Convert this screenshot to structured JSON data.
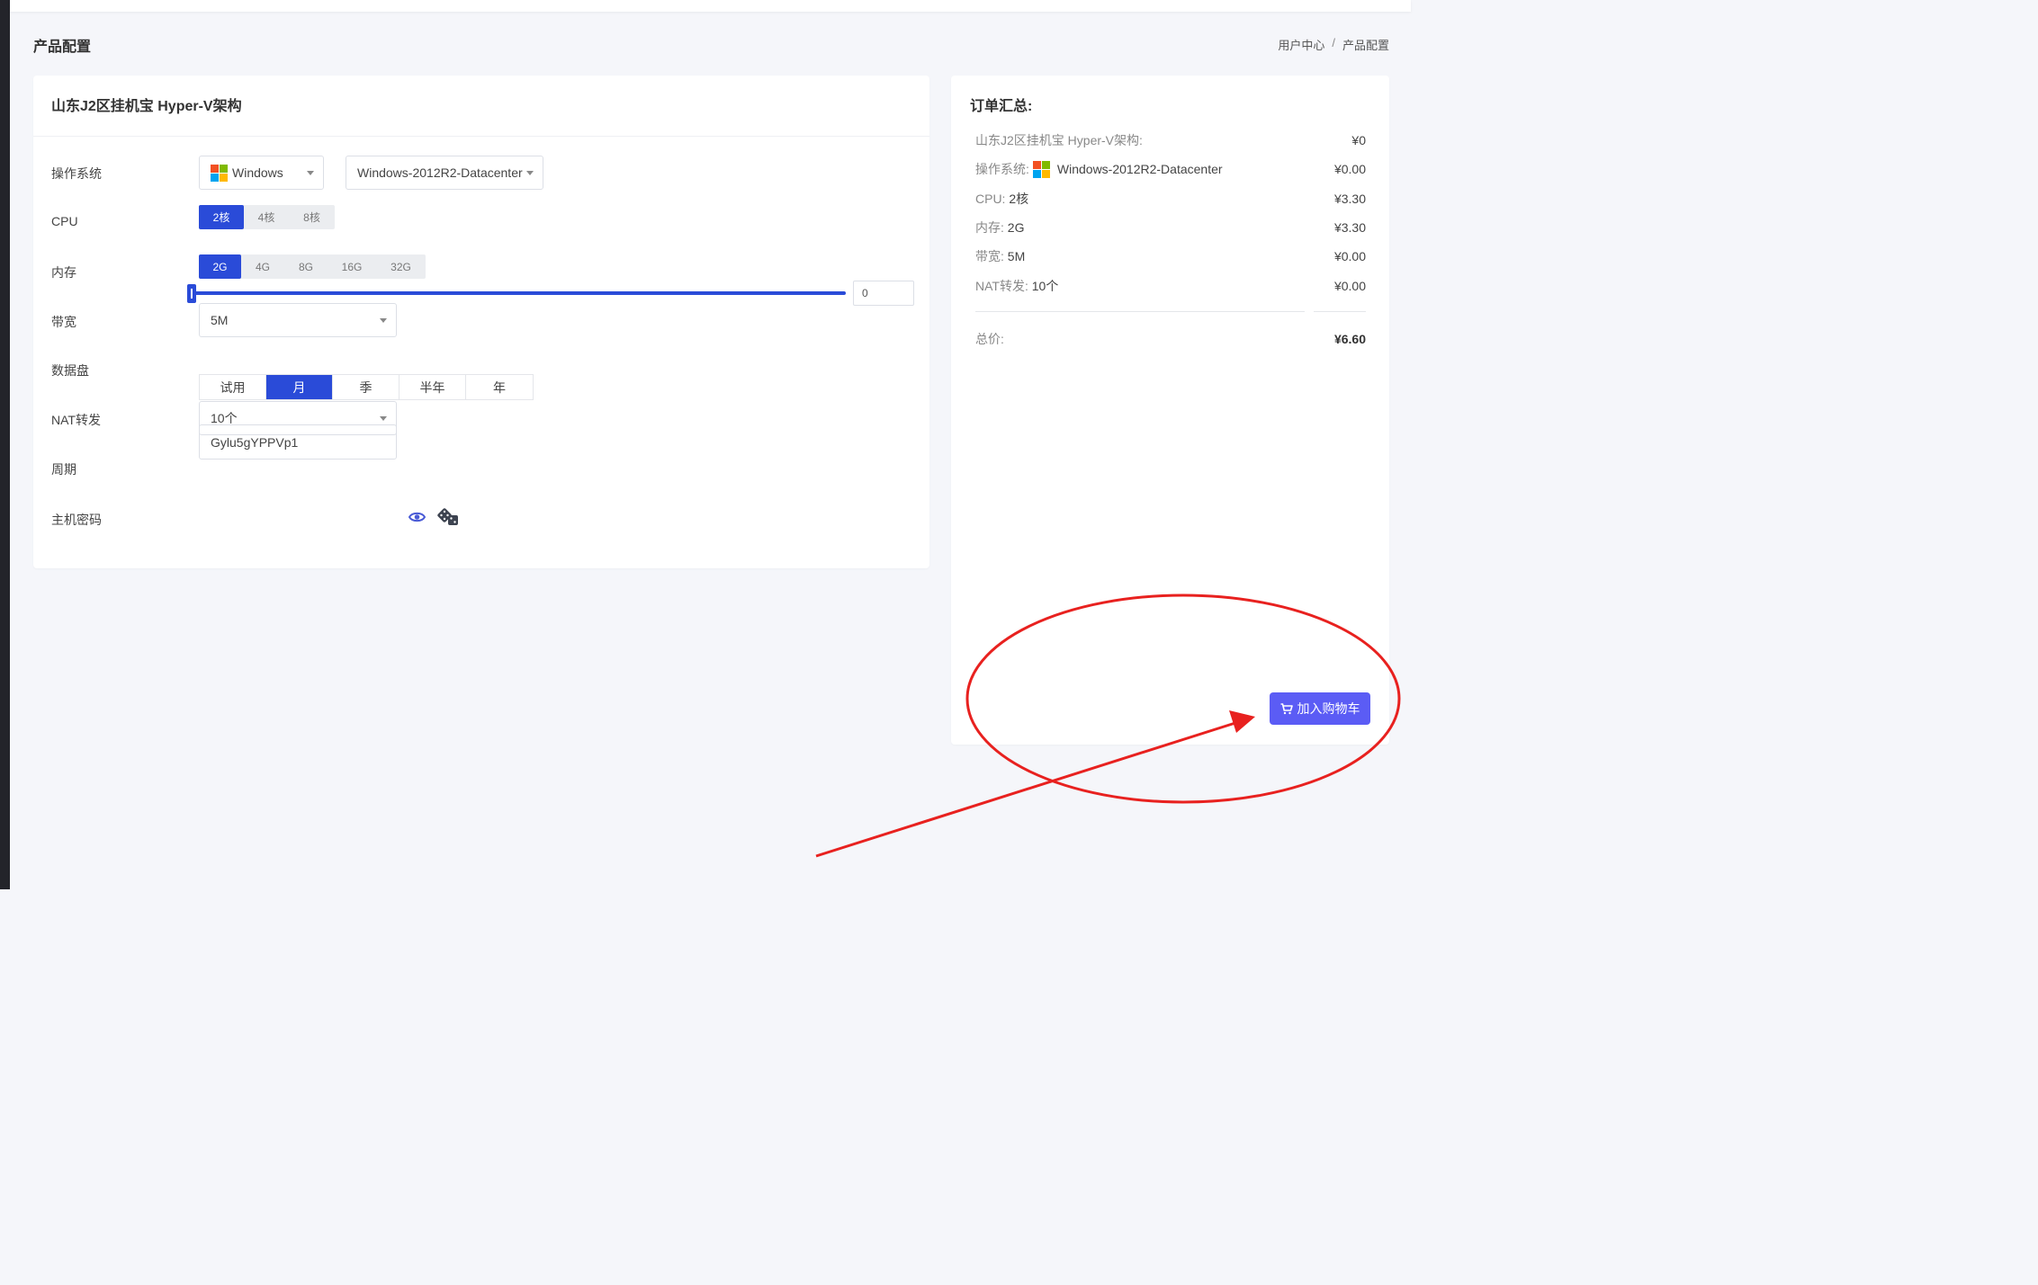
{
  "header": {
    "page_title": "产品配置",
    "breadcrumb": [
      "用户中心",
      "/",
      "产品配置"
    ]
  },
  "config": {
    "product_title": "山东J2区挂机宝 Hyper-V架构",
    "os": {
      "label": "操作系统",
      "family_value": "Windows",
      "version_value": "Windows-2012R2-Datacenter"
    },
    "cpu": {
      "label": "CPU",
      "options": [
        "2核",
        "4核",
        "8核"
      ],
      "selected": "2核"
    },
    "memory": {
      "label": "内存",
      "options": [
        "2G",
        "4G",
        "8G",
        "16G",
        "32G"
      ],
      "selected": "2G"
    },
    "bandwidth": {
      "label": "带宽",
      "value": "5M"
    },
    "data_disk": {
      "label": "数据盘",
      "value": "0"
    },
    "nat": {
      "label": "NAT转发",
      "value": "10个"
    },
    "period": {
      "label": "周期",
      "options": [
        "试用",
        "月",
        "季",
        "半年",
        "年"
      ],
      "selected": "月"
    },
    "password": {
      "label": "主机密码",
      "value": "Gylu5gYPPVp1"
    }
  },
  "summary": {
    "title": "订单汇总:",
    "lines": [
      {
        "key": "山东J2区挂机宝 Hyper-V架构:",
        "value": "",
        "price": "¥0"
      },
      {
        "key": "操作系统:",
        "value": "Windows-2012R2-Datacenter",
        "price": "¥0.00"
      },
      {
        "key": "CPU:",
        "value": "2核",
        "price": "¥3.30"
      },
      {
        "key": "内存:",
        "value": "2G",
        "price": "¥3.30"
      },
      {
        "key": "带宽:",
        "value": "5M",
        "price": "¥0.00"
      },
      {
        "key": "NAT转发:",
        "value": "10个",
        "price": "¥0.00"
      }
    ],
    "total_label": "总价:",
    "total_price": "¥6.60",
    "cart_button": "加入购物车"
  },
  "colors": {
    "primary": "#2a4bd8",
    "cart_button": "#5b5cf5",
    "annotation": "#e8211f"
  },
  "icons": {
    "os_logo": "windows-logo-icon",
    "show_password": "eye-icon",
    "random_password": "dice-icon",
    "cart": "shopping-cart-icon"
  }
}
